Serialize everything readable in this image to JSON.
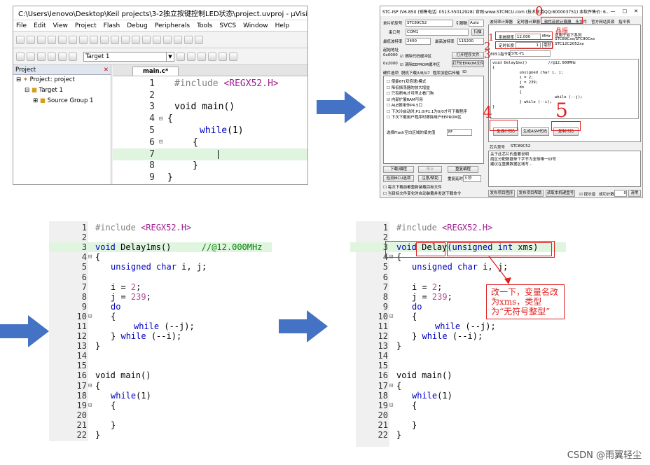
{
  "uvision": {
    "title": "C:\\Users\\lenovo\\Desktop\\Keil projects\\3-2独立按键控制LED状态\\project.uvproj - µVision",
    "menu": [
      "File",
      "Edit",
      "View",
      "Project",
      "Flash",
      "Debug",
      "Peripherals",
      "Tools",
      "SVCS",
      "Window",
      "Help"
    ],
    "target_select": "Target 1",
    "project_pane_title": "Project",
    "tree": [
      "Project: project",
      "Target 1",
      "Source Group 1"
    ],
    "tab": "main.c*",
    "lines": [
      "1",
      "2",
      "3",
      "4",
      "5",
      "6",
      "7",
      "8",
      "9"
    ],
    "code": {
      "l1_pre": "#include",
      "l1_inc": "<REGX52.H>",
      "l3": "void main()",
      "l4": "{",
      "l5_kw": "while",
      "l5_rest": "(1)",
      "l6": "{",
      "l8": "}",
      "l9": "}"
    }
  },
  "isp": {
    "title": "STC-ISP (V6.85I) (销售电话: 0513-55012928) 官网:www.STCMCU.com (技术支持QQ:800003751) 本软件售价: 6...",
    "mcu_label": "单片机型号",
    "mcu_value": "STC89C52",
    "pin_label": "引脚数",
    "pin_value": "Auto",
    "port_label": "串口号",
    "port_value": "COM1",
    "scan": "扫描",
    "minbaud_label": "最低波特率",
    "minbaud_value": "2400",
    "maxbaud_label": "最高波特率",
    "maxbaud_value": "115200",
    "start_addr": "起始地址",
    "addr1": "0x0000",
    "addr2": "0x2000",
    "clear1": "清除代码缓冲区",
    "clear2": "清除EEPROM缓冲区",
    "open_prog": "打开程序文件",
    "open_eeprom": "打开EEPROM文件",
    "hw_tabs": [
      "硬件选项",
      "脱机下载/U8/U7",
      "程序加密后传输",
      "ID"
    ],
    "options": [
      "使能6T(双倍速)模式",
      "降低振荡器的放大增益",
      "只有断电才可停止看门狗",
      "内部扩展RAM可用",
      "ALE脚用作P4.5口",
      "下次冷启动时,P1.0/P1.1为0/0才可下载程序",
      "下次下载用户程序时擦除用户EEPROM区"
    ],
    "flash_label": "选择Flash空白区域的填充值",
    "flash_value": "FF",
    "download": "下载/编程",
    "stop": "停止",
    "reprogram": "重复编程",
    "check_mcu": "检测MCU选项",
    "help": "注意/帮助",
    "delay": "重复延时",
    "delay_val": "3 秒",
    "cb1": "每次下载前都重新装载目标文件",
    "cb2": "当目标文件变化时自动装载并发送下载命令",
    "right_tabs": [
      "波特率计算器",
      "定时器计算器",
      "软件延时计算器",
      "头文件",
      "官方网站资源",
      "指令表"
    ],
    "freq_label": "系统频率",
    "freq_value": "12.000",
    "freq_unit": "MHz",
    "crystal": "晶振",
    "delay_len_label": "定时长度",
    "delay_len_value": "1",
    "delay_unit": "毫秒",
    "ins_set": "8051指令集",
    "ins_value": "STC-Y1",
    "applies": "适用于如下系列",
    "applies2": "STC89Cxx/STC90Cxx",
    "applies3": "STC12C2052xx",
    "gen_code": [
      "void Delay1ms()\t\t//@12.000MHz",
      "{",
      "\tunsigned char i, j;",
      "",
      "\ti = 2;",
      "\tj = 239;",
      "\tdo",
      "\t{",
      "\t\twhile (--j);",
      "\t} while (--i);",
      "}"
    ],
    "gen_c": "生成C代码",
    "gen_asm": "生成ASM代码",
    "copy_code": "复制代码",
    "chip_label": "芯片型号",
    "chip_value": "STC89C52",
    "info": [
      "关于此芯片的重要说明",
      "扇区分配数据单个字节为全球唯一ID号",
      "建议在重要数据区域写..."
    ],
    "bottom_btns": [
      "发布项目程序",
      "发布项目帮助",
      "读取本机硬盘号"
    ],
    "tip": "提示音",
    "count_label": "成功计数",
    "count_value": "0",
    "clear": "清零",
    "marks": [
      "0",
      "1",
      "2",
      "3",
      "4",
      "5"
    ]
  },
  "code_bl": {
    "lines": [
      "1",
      "2",
      "3",
      "4",
      "5",
      "6",
      "7",
      "8",
      "9",
      "10",
      "11",
      "12",
      "13",
      "14",
      "15",
      "16",
      "17",
      "18",
      "19",
      "20",
      "21",
      "22"
    ],
    "c1_pp": "#include",
    "c1_inc": "<REGX52.H>",
    "c3_kw": "void",
    "c3_name": "Delay1ms()",
    "c3_cm": "//@12.000MHz",
    "c4": "{",
    "c5_kw": "unsigned char",
    "c5_rest": "i, j;",
    "c7": "i = ",
    "c7n": "2",
    "c8": "j = ",
    "c8n": "239",
    "c9_kw": "do",
    "c10": "{",
    "c11_kw": "while",
    "c11_rest": "(--j);",
    "c12a": "}",
    "c12_kw": "while",
    "c12_rest": "(--i);",
    "c13": "}",
    "c16": "void main()",
    "c17": "{",
    "c18_kw": "while",
    "c18_rest": "(1)",
    "c19": "{",
    "c21": "}",
    "c22": "}",
    "semi": ";"
  },
  "code_br": {
    "c3_kw": "void",
    "c3_name": "Delay",
    "c3_par_kw": "(unsigned int",
    "c3_par": "xms)",
    "note": "改一下，变量名改为xms，类型为“无符号整型”"
  },
  "watermark": "CSDN @雨翼轻尘",
  "colors": {
    "accent_red": "#e02020",
    "arrow_blue": "#4472c4",
    "keyword": "#0000c0"
  }
}
